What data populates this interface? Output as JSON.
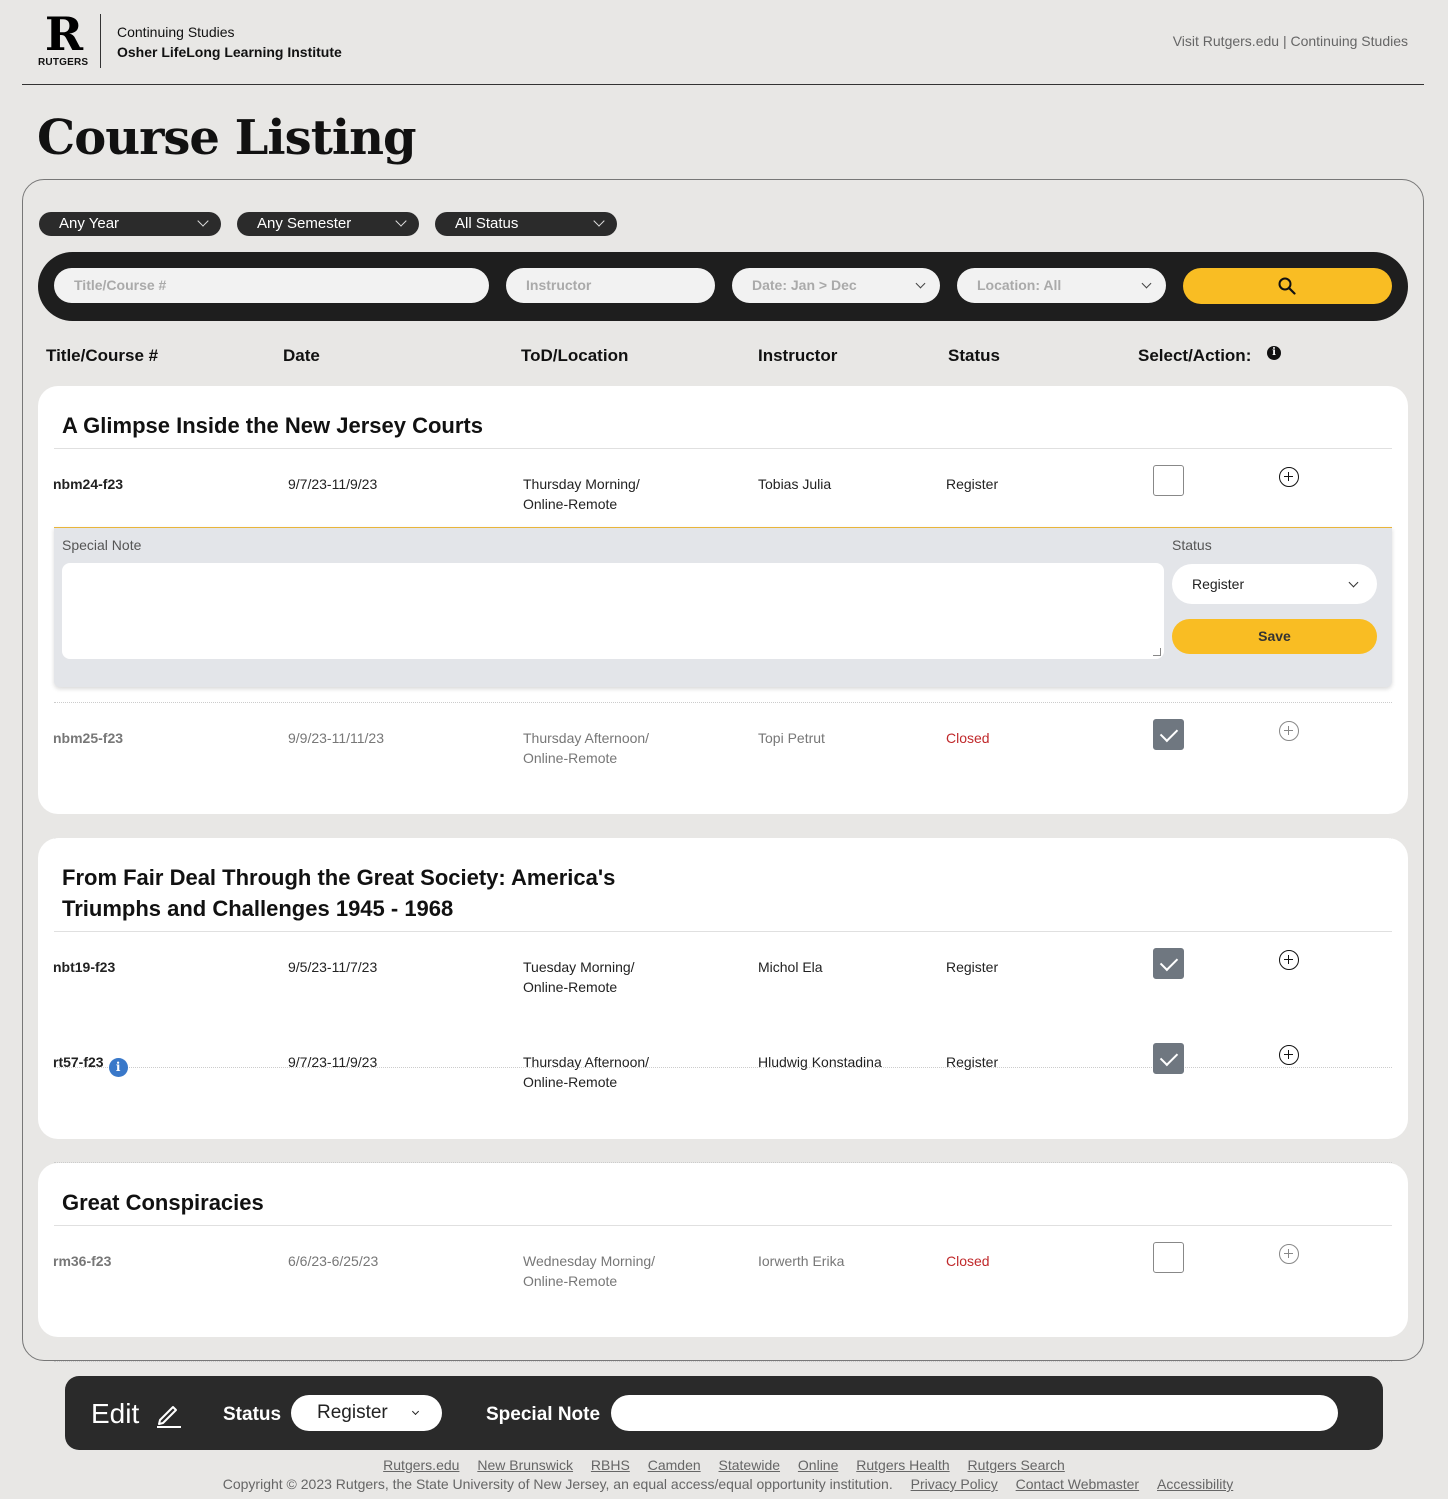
{
  "header": {
    "logo_letter": "R",
    "logo_word": "RUTGERS",
    "org_line1": "Continuing Studies",
    "org_line2": "Osher LifeLong Learning Institute",
    "visit_links": "Visit Rutgers.edu | Continuing Studies"
  },
  "page_title": "Course Listing",
  "filters": {
    "year": "Any Year",
    "semester": "Any Semester",
    "status": "All Status"
  },
  "search": {
    "title_placeholder": "Title/Course #",
    "instructor_placeholder": "Instructor",
    "date": "Date: Jan > Dec",
    "location": "Location: All"
  },
  "columns": {
    "title": "Title/Course #",
    "date": "Date",
    "tod": "ToD/Location",
    "instructor": "Instructor",
    "status": "Status",
    "action": "Select/Action:",
    "info": "i"
  },
  "courses": [
    {
      "title": "A Glimpse Inside the New Jersey Courts",
      "sections": [
        {
          "code": "nbm24-f23",
          "date": "9/7/23-11/9/23",
          "tod1": "Thursday Morning/",
          "tod2": "Online-Remote",
          "instructor": "Tobias Julia",
          "status": "Register",
          "checked": false
        },
        {
          "code": "nbm25-f23",
          "date": "9/9/23-11/11/23",
          "tod1": "Thursday Afternoon/",
          "tod2": "Online-Remote",
          "instructor": "Topi Petrut",
          "status": "Closed",
          "checked": true
        }
      ],
      "note": {
        "label": "Special Note",
        "status_label": "Status",
        "status_value": "Register",
        "save_label": "Save"
      }
    },
    {
      "title_line1": "From Fair Deal Through the Great Society: America's",
      "title_line2": "Triumphs and Challenges 1945 - 1968",
      "sections": [
        {
          "code": "nbt19-f23",
          "date": "9/5/23-11/7/23",
          "tod1": "Tuesday Morning/",
          "tod2": "Online-Remote",
          "instructor": "Michol Ela",
          "status": "Register",
          "checked": true
        },
        {
          "code": "rt57-f23",
          "info": "i",
          "date": "9/7/23-11/9/23",
          "tod1": "Thursday Afternoon/",
          "tod2": "Online-Remote",
          "instructor": "Hludwig Konstadina",
          "status": "Register",
          "checked": true
        }
      ]
    },
    {
      "title": "Great Conspiracies",
      "sections": [
        {
          "code": "rm36-f23",
          "date": "6/6/23-6/25/23",
          "tod1": "Wednesday Morning/",
          "tod2": "Online-Remote",
          "instructor": "Iorwerth Erika",
          "status": "Closed",
          "checked": false
        }
      ]
    }
  ],
  "editbar": {
    "edit_label": "Edit",
    "status_label": "Status",
    "status_value": "Register",
    "note_label": "Special Note"
  },
  "footer": {
    "links": [
      "Rutgers.edu",
      "New Brunswick",
      "RBHS",
      "Camden",
      "Statewide",
      "Online",
      "Rutgers Health",
      "Rutgers Search"
    ],
    "copyright": "Copyright © 2023 Rutgers, the State University of New Jersey, an equal access/equal opportunity institution.",
    "legal_links": [
      "Privacy Policy",
      "Contact Webmaster",
      "Accessibility"
    ]
  },
  "colors": {
    "accent_yellow": "#f9bd23",
    "closed_red": "#c0292b",
    "dark_bar": "#2a2a2a",
    "info_blue": "#3978c9"
  }
}
